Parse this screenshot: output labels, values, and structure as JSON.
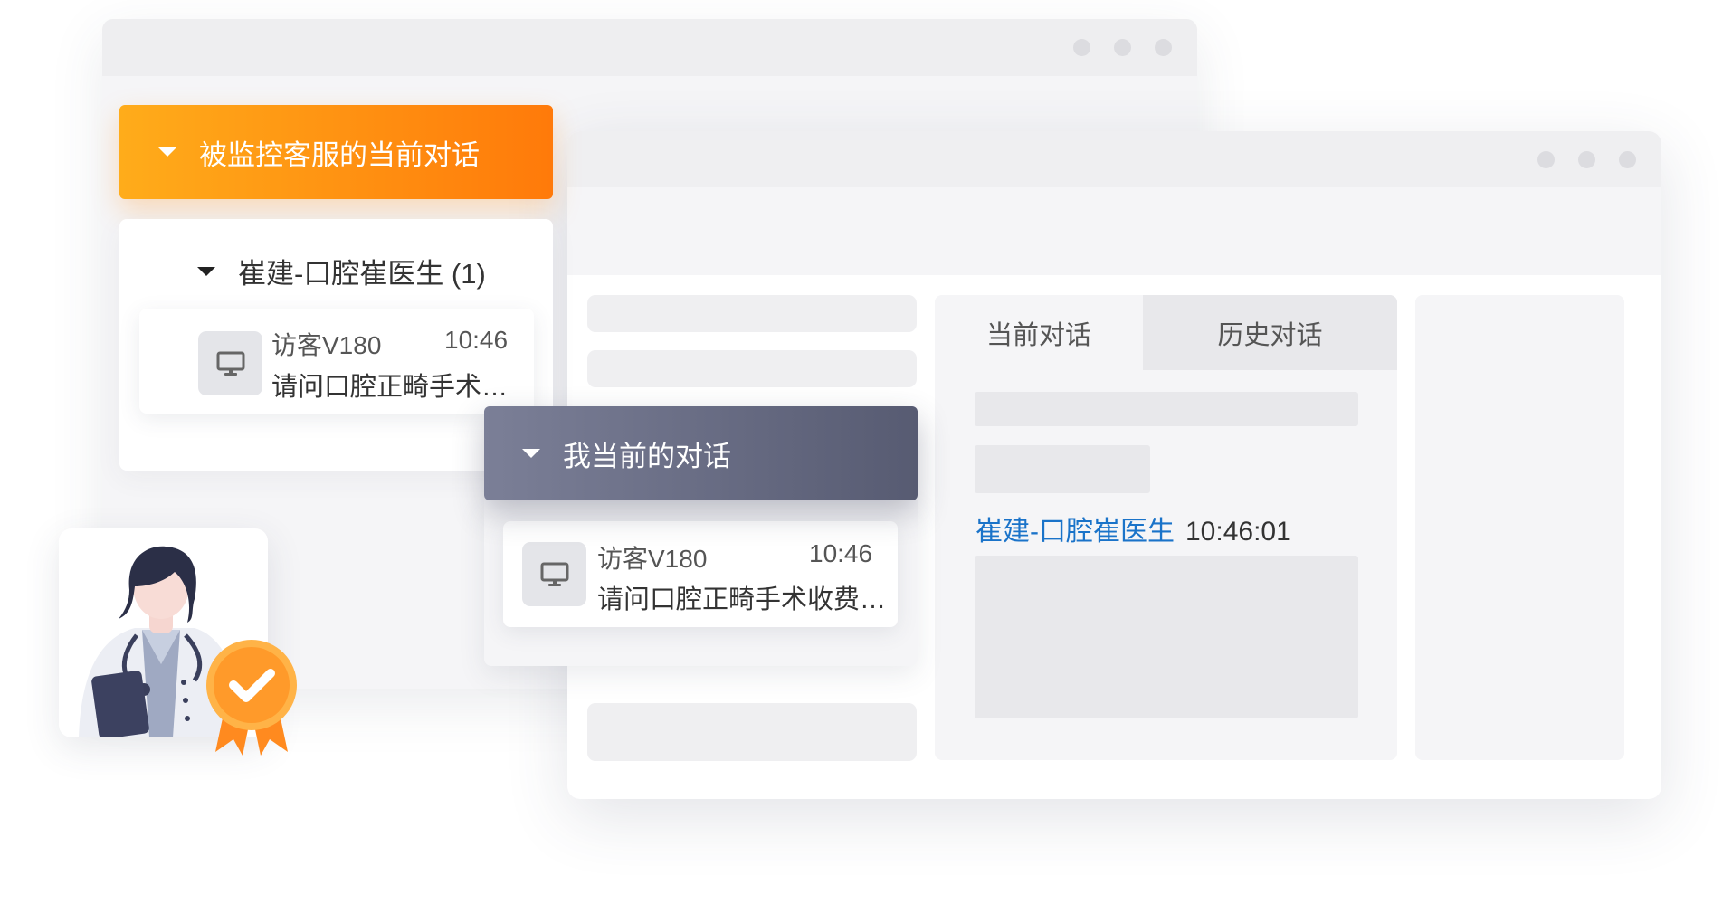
{
  "monitored": {
    "title": "被监控客服的当前对话",
    "agent": "崔建-口腔崔医生 (1)",
    "visitor": {
      "name": "访客V180",
      "time": "10:46",
      "message": "请问口腔正畸手术…"
    }
  },
  "mine": {
    "title": "我当前的对话",
    "visitor": {
      "name": "访客V180",
      "time": "10:46",
      "message": "请问口腔正畸手术收费…"
    }
  },
  "chat": {
    "tabs": [
      "当前对话",
      "历史对话"
    ],
    "active_tab": "当前对话",
    "message_sender": "崔建-口腔崔医生",
    "message_time": "10:46:01"
  },
  "icons": {
    "visitor_device": "desktop-monitor-icon",
    "collapse": "caret-down-icon",
    "badge": "award-check-icon"
  },
  "colors": {
    "accent_orange": "#ff8c10",
    "link_blue": "#1a73c9",
    "dark_header": "#5f6379"
  }
}
